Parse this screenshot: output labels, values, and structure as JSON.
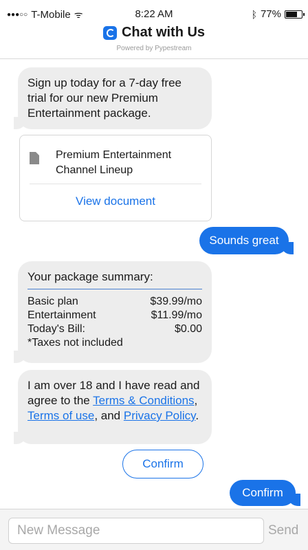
{
  "status_bar": {
    "carrier": "T-Mobile",
    "time": "8:22 AM",
    "battery_percent": "77%",
    "battery_level": 0.77
  },
  "header": {
    "title": "Chat with Us",
    "subtitle": "Powered by Pypestream"
  },
  "messages": {
    "intro": "Sign up today for a 7-day free trial for our new Premium Entertainment package.",
    "document": {
      "title": "Premium Entertainment Channel Lineup",
      "link_label": "View document"
    },
    "reply_1": "Sounds great",
    "summary": {
      "heading": "Your package summary:",
      "rows": [
        {
          "label": "Basic plan",
          "value": "$39.99/mo"
        },
        {
          "label": "Entertainment",
          "value": "$11.99/mo"
        },
        {
          "label": "Today's Bill:",
          "value": "$0.00"
        }
      ],
      "note": "*Taxes not included"
    },
    "terms": {
      "prefix": "I am over 18 and I have read and agree to the ",
      "link1": "Terms & Conditions",
      "sep1": ", ",
      "link2": "Terms of use",
      "sep2": ", and ",
      "link3": "Privacy Policy",
      "suffix": "."
    },
    "confirm_button": "Confirm",
    "reply_2": "Confirm"
  },
  "composer": {
    "placeholder": "New Message",
    "send_label": "Send"
  },
  "colors": {
    "accent": "#1a73e8",
    "bubble_in": "#ededed"
  }
}
